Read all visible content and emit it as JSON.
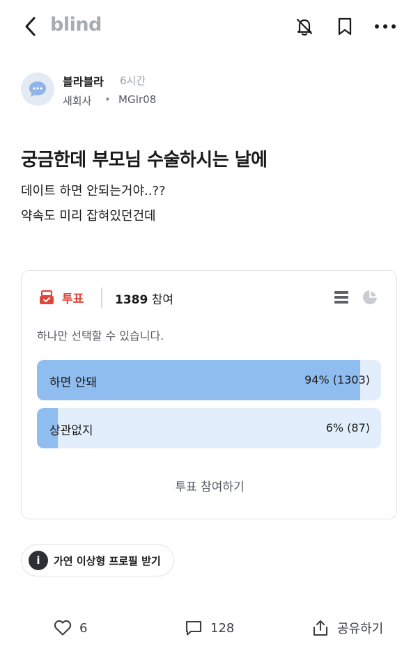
{
  "app": {
    "logo": "blind"
  },
  "author": {
    "name": "블라블라",
    "time": "6시간",
    "company": "새회사",
    "separator": "•",
    "nickname": "MGIr08"
  },
  "post": {
    "title": "궁금한데 부모님 수술하시는 날에",
    "body_lines": [
      "데이트 하면 안되는거야..??",
      "약속도 미리 잡혀있던건데"
    ]
  },
  "poll": {
    "label": "투표",
    "participants": "1389",
    "participants_suffix": "참여",
    "hint": "하나만 선택할 수 있습니다.",
    "options": [
      {
        "label": "하면 안돼",
        "percent": 94,
        "result": "94% (1303)"
      },
      {
        "label": "상관없지",
        "percent": 6,
        "result": "6% (87)"
      }
    ],
    "submit_label": "투표 참여하기"
  },
  "profile_chip": {
    "label": "가연 이상형 프로필 받기"
  },
  "actions": {
    "likes": "6",
    "comments": "128",
    "share_label": "공유하기"
  },
  "colors": {
    "accent_red": "#e0463c",
    "bar_fill": "#90bdef",
    "bar_track": "#e2eefb",
    "logo_gray": "#a7acb3"
  }
}
